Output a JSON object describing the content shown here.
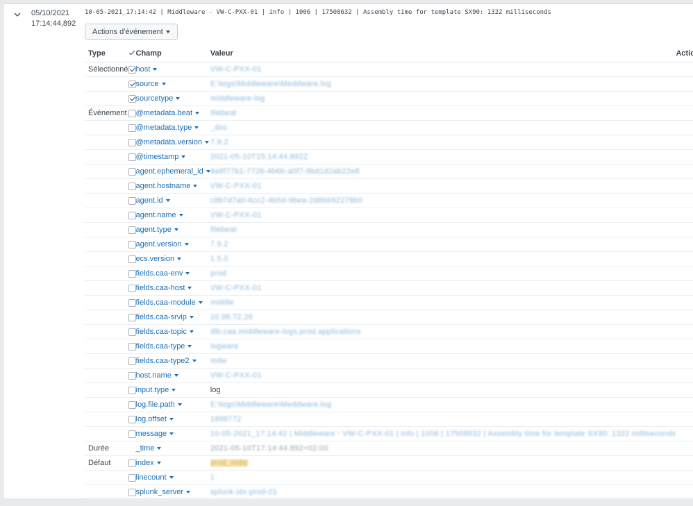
{
  "event": {
    "date": "05/10/2021",
    "time": "17:14:44,892",
    "raw": "10-05-2021_17:14:42 | Middleware - VW-C-PXX-01 | info | 1006 | 17508632 | Assembly time for template SX90: 1322 milliseconds",
    "actions_label": "Actions d'événement"
  },
  "table": {
    "col_type": "Type",
    "col_field": "Champ",
    "col_value": "Valeur",
    "col_actions": "Actions"
  },
  "rows": [
    {
      "type": "Sélectionné",
      "checked": true,
      "field": "host",
      "value": "VW-C-PXX-01",
      "blur": true
    },
    {
      "type": "",
      "checked": true,
      "field": "source",
      "value": "E:\\logs\\Middleware\\Meddware.log",
      "blur": true
    },
    {
      "type": "",
      "checked": true,
      "field": "sourcetype",
      "value": "middleware-log",
      "blur": true
    },
    {
      "type": "Événement",
      "checked": false,
      "field": "@metadata.beat",
      "value": "filebeat",
      "blur": true
    },
    {
      "type": "",
      "checked": false,
      "field": "@metadata.type",
      "value": "_doc",
      "blur": true
    },
    {
      "type": "",
      "checked": false,
      "field": "@metadata.version",
      "value": "7.9.2",
      "blur": true
    },
    {
      "type": "",
      "checked": false,
      "field": "@timestamp",
      "value": "2021-05-10T15:14:44.892Z",
      "blur": true
    },
    {
      "type": "",
      "checked": false,
      "field": "agent.ephemeral_id",
      "value": "4a8f77b1-7726-4b6b-a0f7-9bd1d2ab22e8",
      "blur": true
    },
    {
      "type": "",
      "checked": false,
      "field": "agent.hostname",
      "value": "VW-C-PXX-01",
      "blur": true
    },
    {
      "type": "",
      "checked": false,
      "field": "agent.id",
      "value": "c8b7d7a0-6cc2-4b5d-9bea-2d86692278b0",
      "blur": true
    },
    {
      "type": "",
      "checked": false,
      "field": "agent.name",
      "value": "VW-C-PXX-01",
      "blur": true
    },
    {
      "type": "",
      "checked": false,
      "field": "agent.type",
      "value": "filebeat",
      "blur": true
    },
    {
      "type": "",
      "checked": false,
      "field": "agent.version",
      "value": "7.9.2",
      "blur": true
    },
    {
      "type": "",
      "checked": false,
      "field": "ecs.version",
      "value": "1.5.0",
      "blur": true
    },
    {
      "type": "",
      "checked": false,
      "field": "fields.caa-env",
      "value": "prod",
      "blur": true
    },
    {
      "type": "",
      "checked": false,
      "field": "fields.caa-host",
      "value": "VW-C-PXX-01",
      "blur": true
    },
    {
      "type": "",
      "checked": false,
      "field": "fields.caa-module",
      "value": "middle",
      "blur": true
    },
    {
      "type": "",
      "checked": false,
      "field": "fields.caa-srvip",
      "value": "10.98.72.26",
      "blur": true
    },
    {
      "type": "",
      "checked": false,
      "field": "fields.caa-topic",
      "value": "dlb.caa.middleware-logs.prod.applications",
      "blur": true
    },
    {
      "type": "",
      "checked": false,
      "field": "fields.caa-type",
      "value": "logware",
      "blur": true
    },
    {
      "type": "",
      "checked": false,
      "field": "fields.caa-type2",
      "value": "mdw",
      "blur": true
    },
    {
      "type": "",
      "checked": false,
      "field": "host.name",
      "value": "VW-C-PXX-01",
      "blur": true
    },
    {
      "type": "",
      "checked": false,
      "field": "input.type",
      "value": "log",
      "blur": false
    },
    {
      "type": "",
      "checked": false,
      "field": "log.file.path",
      "value": "E:\\logs\\Middleware\\Meddware.log",
      "blur": true
    },
    {
      "type": "",
      "checked": false,
      "field": "log.offset",
      "value": "1898772",
      "blur": true
    },
    {
      "type": "",
      "checked": false,
      "field": "message",
      "value": "10-05-2021_17:14:42 | Middleware - VW-C-PXX-01 | info | 1006 | 17508632 | Assembly time for template SX90: 1322 milliseconds",
      "blur": true
    },
    {
      "type": "Durée",
      "checked": null,
      "field": "_time",
      "value": "2021-05-10T17:14:44.892+02:00",
      "blur": true,
      "gray": true,
      "no_action": true
    },
    {
      "type": "Défaut",
      "checked": false,
      "field": "index",
      "value": "prod_mdw",
      "blur": true,
      "highlight": true
    },
    {
      "type": "",
      "checked": false,
      "field": "linecount",
      "value": "1",
      "blur": true
    },
    {
      "type": "",
      "checked": false,
      "field": "splunk_server",
      "value": "splunk-idx-prod-01",
      "blur": true
    }
  ]
}
